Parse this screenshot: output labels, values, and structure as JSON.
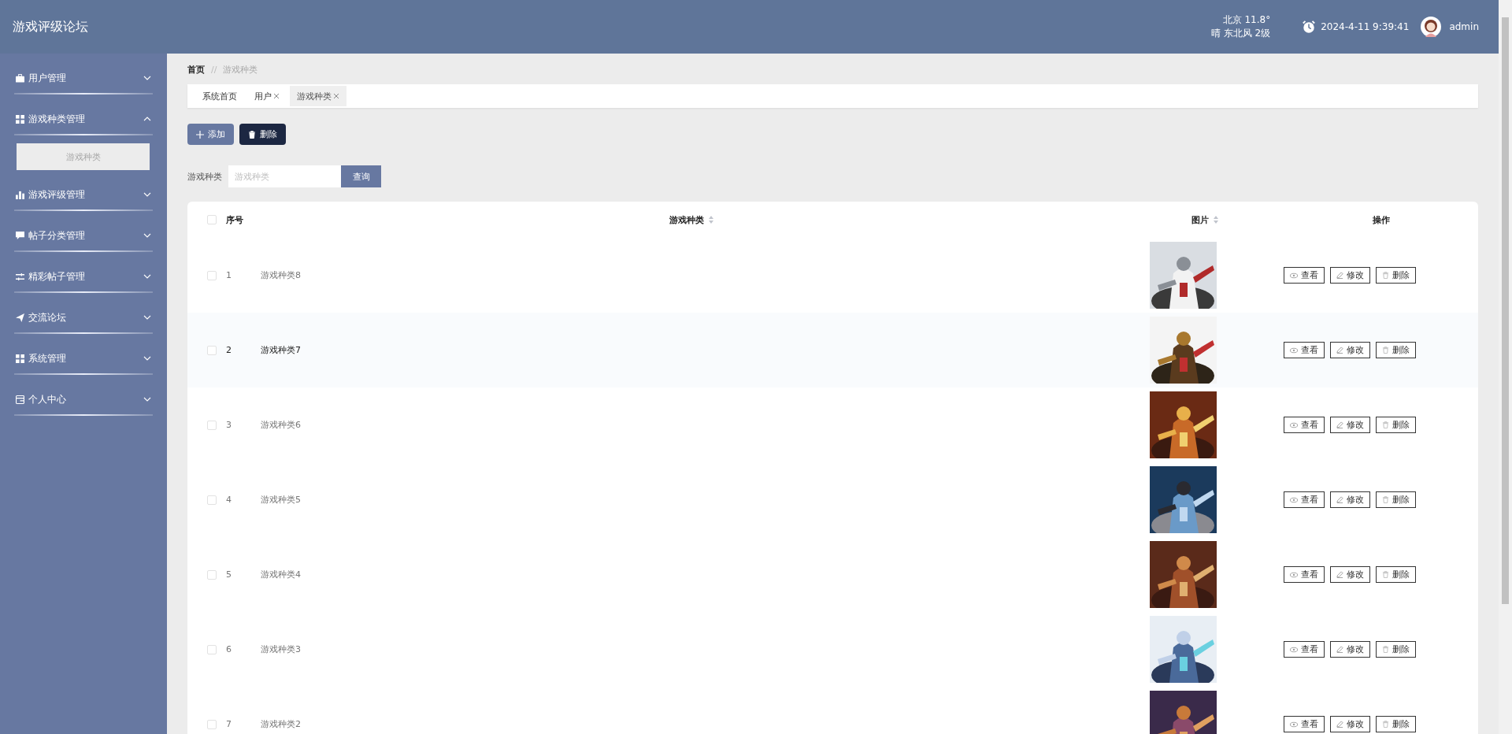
{
  "header": {
    "title": "游戏评级论坛",
    "weather": {
      "line_1": "北京  11.8°",
      "line_2": "晴  东北风  2级"
    },
    "datetime": "2024-4-11 9:39:41",
    "user": "admin"
  },
  "sidebar": {
    "items": [
      {
        "label": "用户管理",
        "expanded": false
      },
      {
        "label": "游戏种类管理",
        "expanded": true,
        "children": [
          {
            "label": "游戏种类",
            "selected": true
          }
        ]
      },
      {
        "label": "游戏评级管理",
        "expanded": false
      },
      {
        "label": "帖子分类管理",
        "expanded": false
      },
      {
        "label": "精彩帖子管理",
        "expanded": false
      },
      {
        "label": "交流论坛",
        "expanded": false
      },
      {
        "label": "系统管理",
        "expanded": false
      },
      {
        "label": "个人中心",
        "expanded": false
      }
    ]
  },
  "breadcrumb": {
    "home": "首页",
    "separator": "//",
    "current": "游戏种类"
  },
  "tabs": [
    {
      "label": "系统首页",
      "closable": false,
      "selected": false
    },
    {
      "label": "用户",
      "closable": true,
      "selected": false
    },
    {
      "label": "游戏种类",
      "closable": true,
      "selected": true
    }
  ],
  "toolbar": {
    "add": "添加",
    "delete": "删除"
  },
  "search": {
    "label": "游戏种类",
    "placeholder": "游戏种类",
    "button": "查询"
  },
  "table": {
    "select_all_checked": false,
    "columns": [
      {
        "label": "序号",
        "sortable": false
      },
      {
        "label": "游戏种类",
        "sortable": true
      },
      {
        "label": "图片",
        "sortable": true
      },
      {
        "label": "操作",
        "sortable": false
      }
    ],
    "rows": [
      {
        "index": "1",
        "name": "游戏种类8",
        "hovered": false,
        "checked": false,
        "actions": [
          "查看",
          "修改",
          "删除"
        ]
      },
      {
        "index": "2",
        "name": "游戏种类7",
        "hovered": true,
        "checked": false,
        "actions": [
          "查看",
          "修改",
          "删除"
        ]
      },
      {
        "index": "3",
        "name": "游戏种类6",
        "hovered": false,
        "checked": false,
        "actions": [
          "查看",
          "修改",
          "删除"
        ]
      },
      {
        "index": "4",
        "name": "游戏种类5",
        "hovered": false,
        "checked": false,
        "actions": [
          "查看",
          "修改",
          "删除"
        ]
      },
      {
        "index": "5",
        "name": "游戏种类4",
        "hovered": false,
        "checked": false,
        "actions": [
          "查看",
          "修改",
          "删除"
        ]
      },
      {
        "index": "6",
        "name": "游戏种类3",
        "hovered": false,
        "checked": false,
        "actions": [
          "查看",
          "修改",
          "删除"
        ]
      },
      {
        "index": "7",
        "name": "游戏种类2",
        "hovered": false,
        "checked": false,
        "actions": [
          "查看",
          "修改",
          "删除"
        ]
      }
    ]
  }
}
